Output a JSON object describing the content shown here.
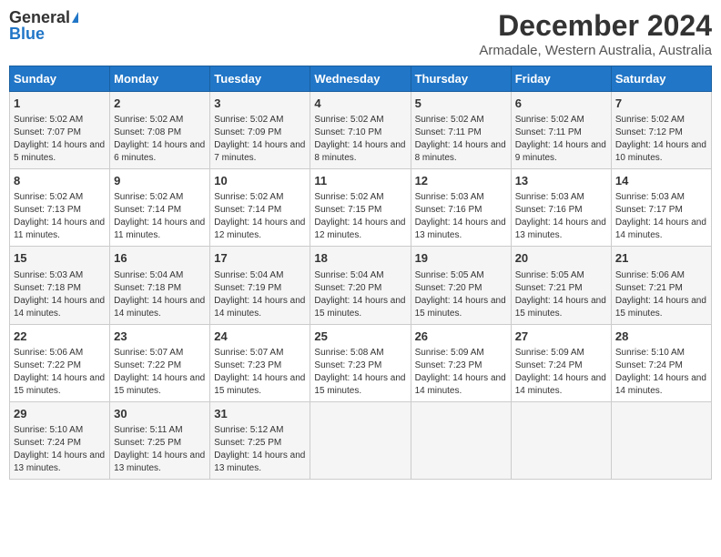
{
  "logo": {
    "general": "General",
    "blue": "Blue"
  },
  "title": "December 2024",
  "subtitle": "Armadale, Western Australia, Australia",
  "days_of_week": [
    "Sunday",
    "Monday",
    "Tuesday",
    "Wednesday",
    "Thursday",
    "Friday",
    "Saturday"
  ],
  "weeks": [
    [
      {
        "day": "1",
        "sunrise": "5:02 AM",
        "sunset": "7:07 PM",
        "daylight": "14 hours and 5 minutes."
      },
      {
        "day": "2",
        "sunrise": "5:02 AM",
        "sunset": "7:08 PM",
        "daylight": "14 hours and 6 minutes."
      },
      {
        "day": "3",
        "sunrise": "5:02 AM",
        "sunset": "7:09 PM",
        "daylight": "14 hours and 7 minutes."
      },
      {
        "day": "4",
        "sunrise": "5:02 AM",
        "sunset": "7:10 PM",
        "daylight": "14 hours and 8 minutes."
      },
      {
        "day": "5",
        "sunrise": "5:02 AM",
        "sunset": "7:11 PM",
        "daylight": "14 hours and 8 minutes."
      },
      {
        "day": "6",
        "sunrise": "5:02 AM",
        "sunset": "7:11 PM",
        "daylight": "14 hours and 9 minutes."
      },
      {
        "day": "7",
        "sunrise": "5:02 AM",
        "sunset": "7:12 PM",
        "daylight": "14 hours and 10 minutes."
      }
    ],
    [
      {
        "day": "8",
        "sunrise": "5:02 AM",
        "sunset": "7:13 PM",
        "daylight": "14 hours and 11 minutes."
      },
      {
        "day": "9",
        "sunrise": "5:02 AM",
        "sunset": "7:14 PM",
        "daylight": "14 hours and 11 minutes."
      },
      {
        "day": "10",
        "sunrise": "5:02 AM",
        "sunset": "7:14 PM",
        "daylight": "14 hours and 12 minutes."
      },
      {
        "day": "11",
        "sunrise": "5:02 AM",
        "sunset": "7:15 PM",
        "daylight": "14 hours and 12 minutes."
      },
      {
        "day": "12",
        "sunrise": "5:03 AM",
        "sunset": "7:16 PM",
        "daylight": "14 hours and 13 minutes."
      },
      {
        "day": "13",
        "sunrise": "5:03 AM",
        "sunset": "7:16 PM",
        "daylight": "14 hours and 13 minutes."
      },
      {
        "day": "14",
        "sunrise": "5:03 AM",
        "sunset": "7:17 PM",
        "daylight": "14 hours and 14 minutes."
      }
    ],
    [
      {
        "day": "15",
        "sunrise": "5:03 AM",
        "sunset": "7:18 PM",
        "daylight": "14 hours and 14 minutes."
      },
      {
        "day": "16",
        "sunrise": "5:04 AM",
        "sunset": "7:18 PM",
        "daylight": "14 hours and 14 minutes."
      },
      {
        "day": "17",
        "sunrise": "5:04 AM",
        "sunset": "7:19 PM",
        "daylight": "14 hours and 14 minutes."
      },
      {
        "day": "18",
        "sunrise": "5:04 AM",
        "sunset": "7:20 PM",
        "daylight": "14 hours and 15 minutes."
      },
      {
        "day": "19",
        "sunrise": "5:05 AM",
        "sunset": "7:20 PM",
        "daylight": "14 hours and 15 minutes."
      },
      {
        "day": "20",
        "sunrise": "5:05 AM",
        "sunset": "7:21 PM",
        "daylight": "14 hours and 15 minutes."
      },
      {
        "day": "21",
        "sunrise": "5:06 AM",
        "sunset": "7:21 PM",
        "daylight": "14 hours and 15 minutes."
      }
    ],
    [
      {
        "day": "22",
        "sunrise": "5:06 AM",
        "sunset": "7:22 PM",
        "daylight": "14 hours and 15 minutes."
      },
      {
        "day": "23",
        "sunrise": "5:07 AM",
        "sunset": "7:22 PM",
        "daylight": "14 hours and 15 minutes."
      },
      {
        "day": "24",
        "sunrise": "5:07 AM",
        "sunset": "7:23 PM",
        "daylight": "14 hours and 15 minutes."
      },
      {
        "day": "25",
        "sunrise": "5:08 AM",
        "sunset": "7:23 PM",
        "daylight": "14 hours and 15 minutes."
      },
      {
        "day": "26",
        "sunrise": "5:09 AM",
        "sunset": "7:23 PM",
        "daylight": "14 hours and 14 minutes."
      },
      {
        "day": "27",
        "sunrise": "5:09 AM",
        "sunset": "7:24 PM",
        "daylight": "14 hours and 14 minutes."
      },
      {
        "day": "28",
        "sunrise": "5:10 AM",
        "sunset": "7:24 PM",
        "daylight": "14 hours and 14 minutes."
      }
    ],
    [
      {
        "day": "29",
        "sunrise": "5:10 AM",
        "sunset": "7:24 PM",
        "daylight": "14 hours and 13 minutes."
      },
      {
        "day": "30",
        "sunrise": "5:11 AM",
        "sunset": "7:25 PM",
        "daylight": "14 hours and 13 minutes."
      },
      {
        "day": "31",
        "sunrise": "5:12 AM",
        "sunset": "7:25 PM",
        "daylight": "14 hours and 13 minutes."
      },
      null,
      null,
      null,
      null
    ]
  ]
}
